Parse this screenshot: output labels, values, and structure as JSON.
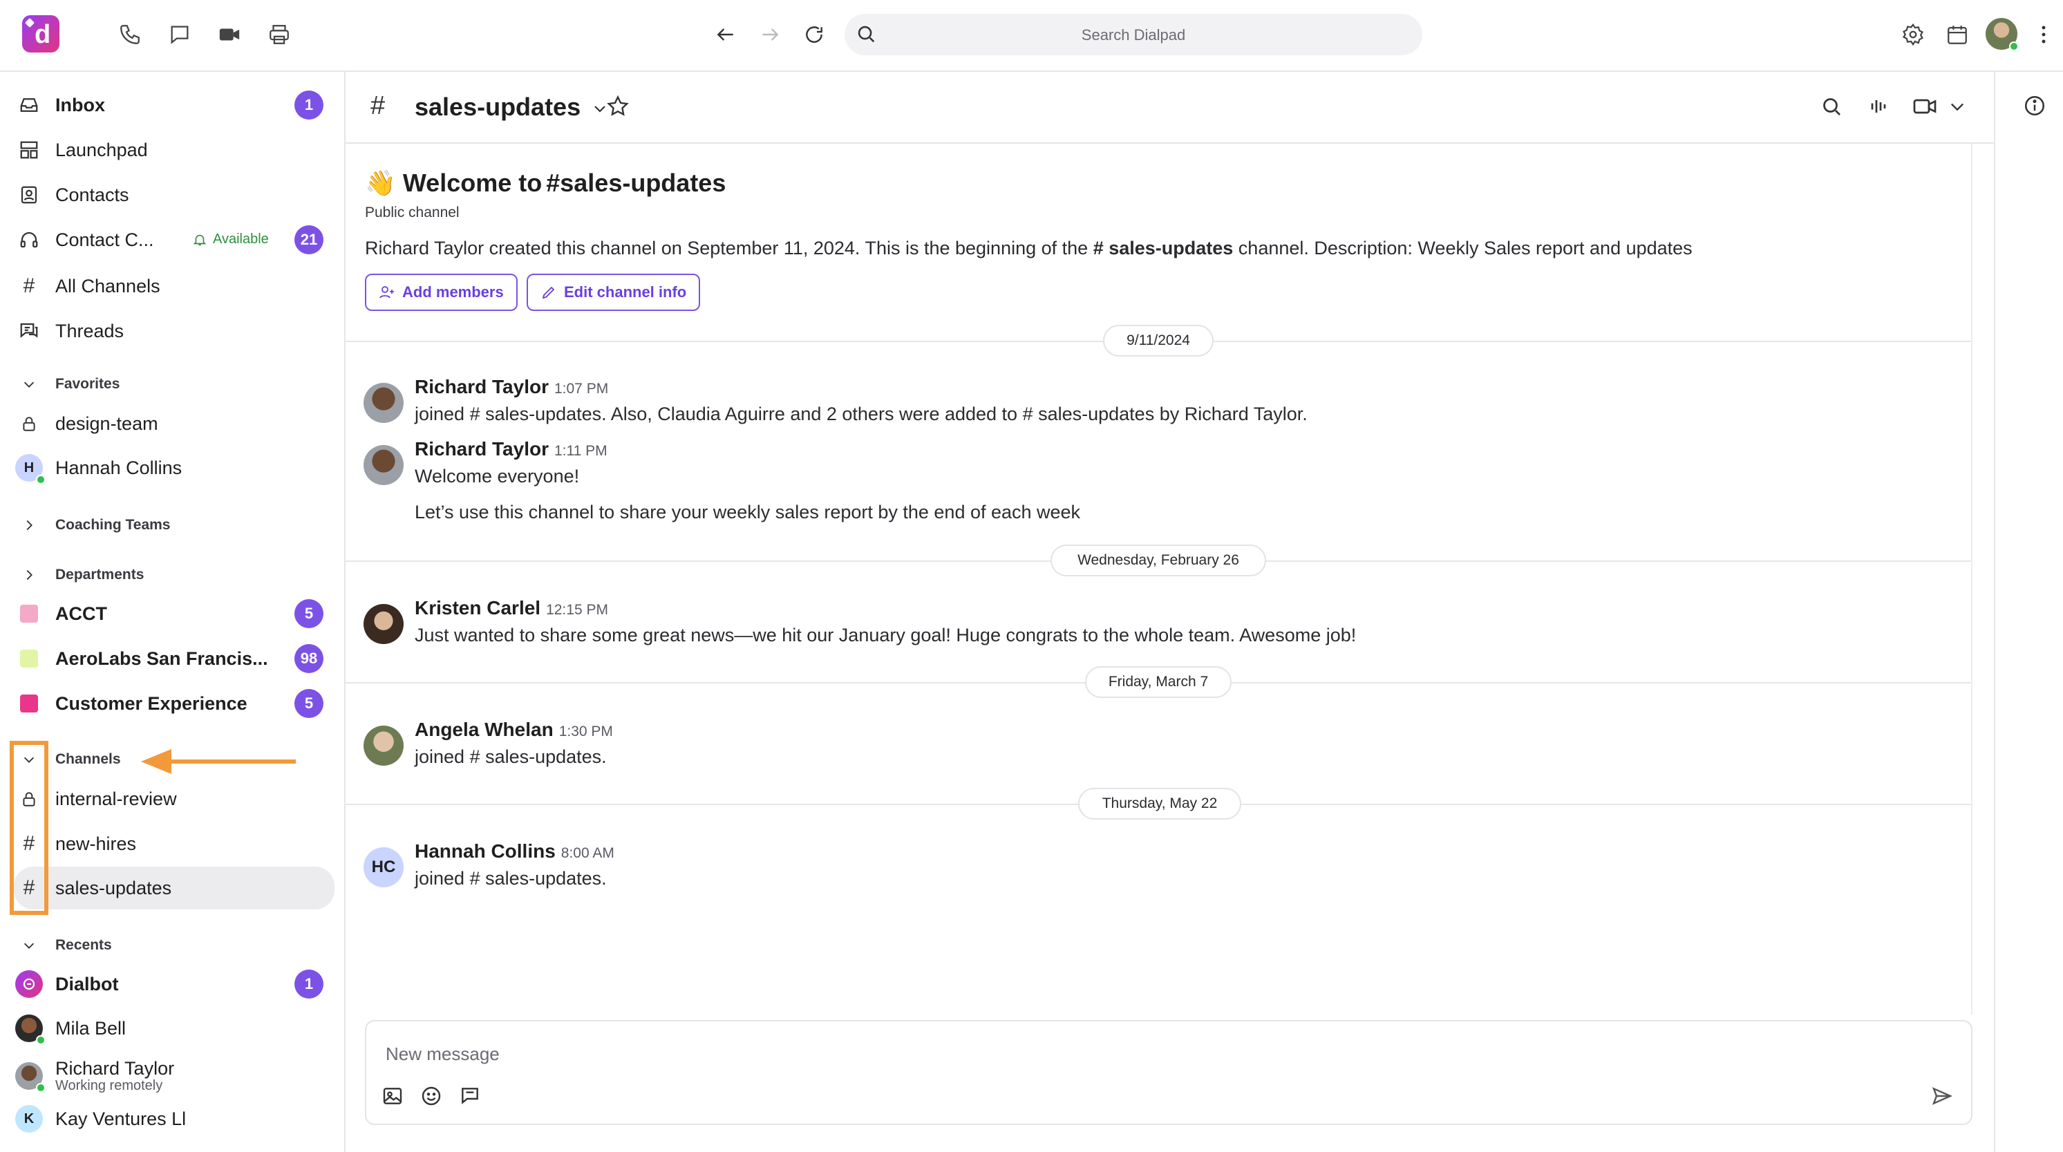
{
  "topbar": {
    "search_placeholder": "Search Dialpad",
    "icons": [
      "phone-icon",
      "chat-icon",
      "video-icon",
      "printer-icon",
      "back-arrow-icon",
      "forward-arrow-icon",
      "refresh-icon",
      "search-icon",
      "gear-icon",
      "calendar-icon",
      "more-vertical-icon"
    ]
  },
  "sidebar": {
    "primary": [
      {
        "label": "Inbox",
        "badge": "1",
        "icon": "inbox-icon"
      },
      {
        "label": "Launchpad",
        "icon": "launchpad-icon"
      },
      {
        "label": "Contacts",
        "icon": "contacts-icon"
      },
      {
        "label": "Contact C...",
        "status": "Available",
        "badge": "21",
        "icon": "headset-icon"
      },
      {
        "label": "All Channels",
        "icon": "hash-icon"
      },
      {
        "label": "Threads",
        "icon": "threads-icon"
      }
    ],
    "favorites": {
      "title": "Favorites",
      "items": [
        {
          "label": "design-team",
          "icon": "lock-icon"
        },
        {
          "label": "Hannah Collins",
          "initial": "H"
        }
      ]
    },
    "coaching_teams": {
      "title": "Coaching Teams"
    },
    "departments": {
      "title": "Departments",
      "items": [
        {
          "label": "ACCT",
          "badge": "5",
          "color": "#f4a9c6"
        },
        {
          "label": "AeroLabs San Francis...",
          "badge": "98",
          "color": "#e2f5a6"
        },
        {
          "label": "Customer Experience",
          "badge": "5",
          "color": "#e8368a"
        }
      ]
    },
    "channels": {
      "title": "Channels",
      "items": [
        {
          "label": "internal-review",
          "icon": "lock-icon"
        },
        {
          "label": "new-hires",
          "icon": "hash-icon"
        },
        {
          "label": "sales-updates",
          "icon": "hash-icon",
          "selected": true
        }
      ]
    },
    "recents": {
      "title": "Recents",
      "items": [
        {
          "label": "Dialbot",
          "badge": "1"
        },
        {
          "label": "Mila Bell"
        },
        {
          "label": "Richard Taylor",
          "sub": "Working remotely"
        },
        {
          "label": "Kay Ventures Ll",
          "initial": "K"
        }
      ]
    },
    "highlight_color": "#f29a3a"
  },
  "channel": {
    "hash": "#",
    "name": "sales-updates",
    "welcome_emoji": "👋",
    "welcome_prefix": "Welcome to",
    "welcome_hash": "#",
    "welcome_name": "sales-updates",
    "type": "Public channel",
    "description_before": "Richard Taylor created this channel on September 11, 2024. This is the beginning of the",
    "description_hash_name": "# sales-updates",
    "description_after": "channel. Description: Weekly Sales report and updates",
    "add_members": "Add members",
    "edit_info": "Edit channel info"
  },
  "dates": [
    "9/11/2024",
    "Wednesday, February 26",
    "Friday, March 7",
    "Thursday, May 22"
  ],
  "messages": [
    {
      "author": "Richard Taylor",
      "time": "1:07 PM",
      "lines": [
        "joined # sales-updates. Also, Claudia Aguirre and 2 others were added to # sales-updates by Richard Taylor."
      ]
    },
    {
      "author": "Richard Taylor",
      "time": "1:11 PM",
      "lines": [
        "Welcome everyone!",
        "Let’s use this channel to share your weekly sales report by the end of each week"
      ]
    },
    {
      "author": "Kristen Carlel",
      "time": "12:15 PM",
      "lines": [
        "Just wanted to share some great news—we hit our January goal! Huge congrats to the whole team. Awesome job!"
      ]
    },
    {
      "author": "Angela Whelan",
      "time": "1:30 PM",
      "lines": [
        "joined # sales-updates."
      ]
    },
    {
      "author": "Hannah Collins",
      "time": "8:00 AM",
      "initials": "HC",
      "lines": [
        "joined # sales-updates."
      ]
    }
  ],
  "composer": {
    "placeholder": "New message"
  },
  "colors": {
    "accent": "#7c52e6",
    "badge": "#7c52e6",
    "highlight": "#f29a3a",
    "presence": "#2fbf4a"
  }
}
